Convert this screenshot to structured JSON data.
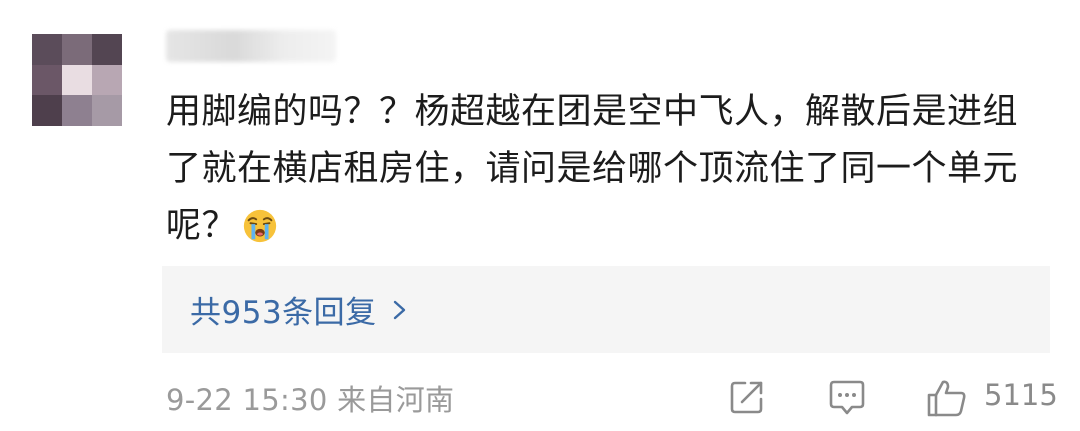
{
  "comment": {
    "avatar_colors": [
      [
        "#5b4c5a",
        "#7b6b79",
        "#534552"
      ],
      [
        "#6b5767",
        "#e9dde2",
        "#b8a7b3"
      ],
      [
        "#4e3f4c",
        "#8e8090",
        "#a69aa6"
      ]
    ],
    "text": "用脚编的吗？？杨超越在团是空中飞人，解散后是进组了就在横店租房住，请问是给哪个顶流住了同一个单元呢？",
    "emoji": "crying-face-emoji"
  },
  "replies": {
    "label": "共953条回复"
  },
  "meta": {
    "time_location": "9-22 15:30 来自河南"
  },
  "actions": {
    "like_count": "5115"
  },
  "colors": {
    "text": "#1c1c1c",
    "link": "#3b6aa6",
    "muted": "#9a9a9a",
    "reply_bg": "#f5f5f5"
  }
}
